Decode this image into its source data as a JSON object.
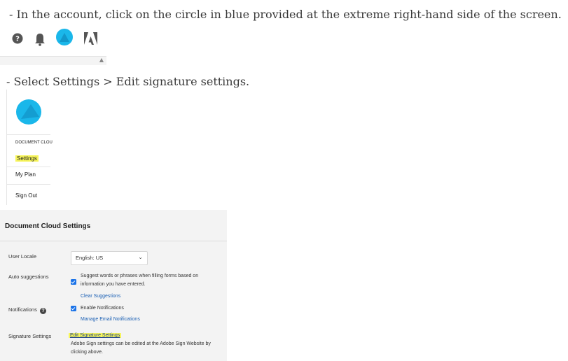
{
  "instructions": {
    "step1": "- In the account, click on the circle in blue provided at the extreme right-hand side of the screen.",
    "step2": "- Select Settings > Edit signature settings."
  },
  "icons": [
    "help-icon",
    "bell-icon",
    "avatar-circle-icon",
    "adobe-logo-icon"
  ],
  "colors": {
    "accent_blue": "#1ab7ea",
    "link_blue": "#1a5fb4",
    "highlight": "#f7f55a",
    "checkbox_blue": "#1b73e8"
  },
  "menu": {
    "section_label": "DOCUMENT CLOU",
    "items": [
      "Settings",
      "My Plan",
      "Sign Out"
    ]
  },
  "settings": {
    "title": "Document Cloud Settings",
    "user_locale": {
      "label": "User Locale",
      "value": "English: US"
    },
    "auto_suggestions": {
      "label": "Auto suggestions",
      "text_line1": "Suggest words or phrases when filling forms based on",
      "text_line2": "information you have entered.",
      "link": "Clear Suggestions"
    },
    "notifications": {
      "label": "Notifications",
      "option": "Enable Notifications",
      "link": "Manage Email Notifications"
    },
    "signature": {
      "label": "Signature Settings",
      "link": "Edit Signature Settings",
      "text_line1": "Adobe Sign settings can be edited at the Adobe Sign Website by",
      "text_line2": "clicking above."
    }
  }
}
